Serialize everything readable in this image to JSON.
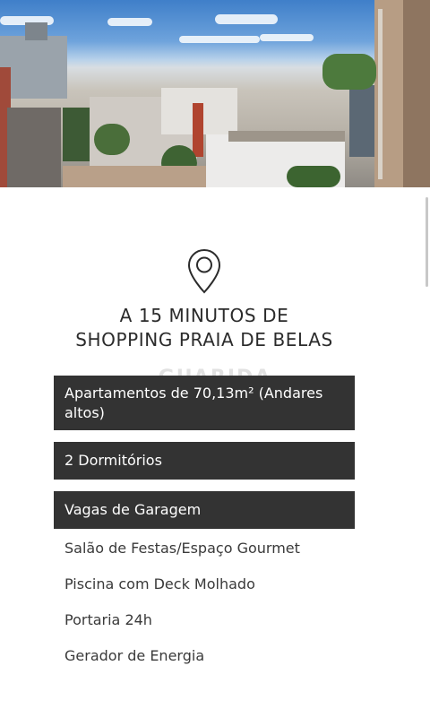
{
  "hero": {
    "image_alt": "city-skyline-photo"
  },
  "pin_icon": "map-pin-icon",
  "headline": {
    "line1": "A 15 MINUTOS DE",
    "line2": "SHOPPING PRAIA DE BELAS"
  },
  "watermark": "GUARIDA",
  "highlighted_features": [
    "Apartamentos de 70,13m² (Andares altos)",
    "2 Dormitórios",
    "Vagas de Garagem"
  ],
  "features": [
    "Salão de Festas/Espaço Gourmet",
    "Piscina com Deck Molhado",
    "Portaria 24h",
    "Gerador de Energia"
  ],
  "colors": {
    "box_bg": "#333333",
    "box_text": "#ffffff",
    "text": "#2e2e2e"
  }
}
